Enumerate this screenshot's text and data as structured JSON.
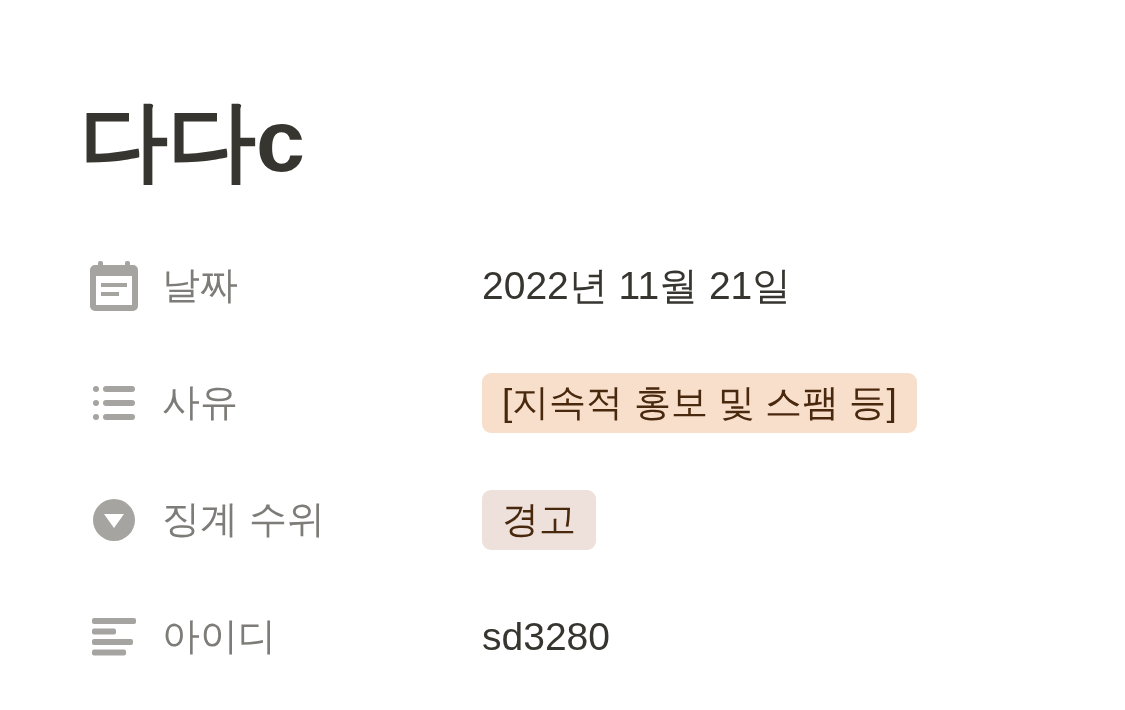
{
  "page": {
    "title": "다다c"
  },
  "properties": [
    {
      "kind": "date",
      "label": "날짜",
      "text": "2022년 11월 21일"
    },
    {
      "kind": "multi_select",
      "label": "사유",
      "tags": [
        {
          "text": "[지속적 홍보 및 스팸 등]",
          "color": "#f8dfcc"
        }
      ]
    },
    {
      "kind": "select",
      "label": "징계 수위",
      "tags": [
        {
          "text": "경고",
          "color": "#eee0da"
        }
      ]
    },
    {
      "kind": "text",
      "label": "아이디",
      "text": "sd3280"
    }
  ]
}
